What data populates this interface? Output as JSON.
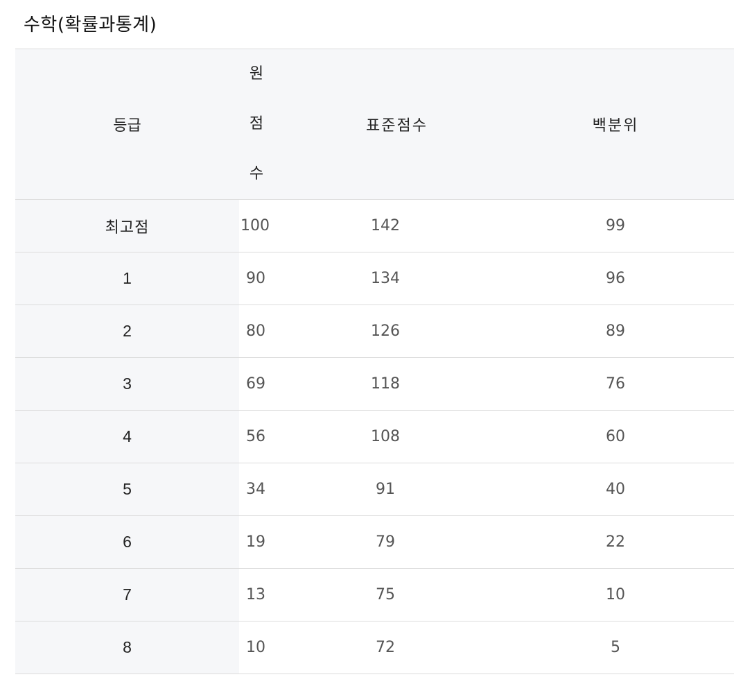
{
  "title": "수학(확률과통계)",
  "table": {
    "headers": {
      "grade": "등급",
      "raw_chars": [
        "원",
        "점",
        "수"
      ],
      "standard": "표준점수",
      "percentile": "백분위"
    },
    "rows": [
      {
        "grade": "최고점",
        "raw": "100",
        "standard": "142",
        "percentile": "99"
      },
      {
        "grade": "1",
        "raw": "90",
        "standard": "134",
        "percentile": "96"
      },
      {
        "grade": "2",
        "raw": "80",
        "standard": "126",
        "percentile": "89"
      },
      {
        "grade": "3",
        "raw": "69",
        "standard": "118",
        "percentile": "76"
      },
      {
        "grade": "4",
        "raw": "56",
        "standard": "108",
        "percentile": "60"
      },
      {
        "grade": "5",
        "raw": "34",
        "standard": "91",
        "percentile": "40"
      },
      {
        "grade": "6",
        "raw": "19",
        "standard": "79",
        "percentile": "22"
      },
      {
        "grade": "7",
        "raw": "13",
        "standard": "75",
        "percentile": "10"
      },
      {
        "grade": "8",
        "raw": "10",
        "standard": "72",
        "percentile": "5"
      }
    ]
  }
}
